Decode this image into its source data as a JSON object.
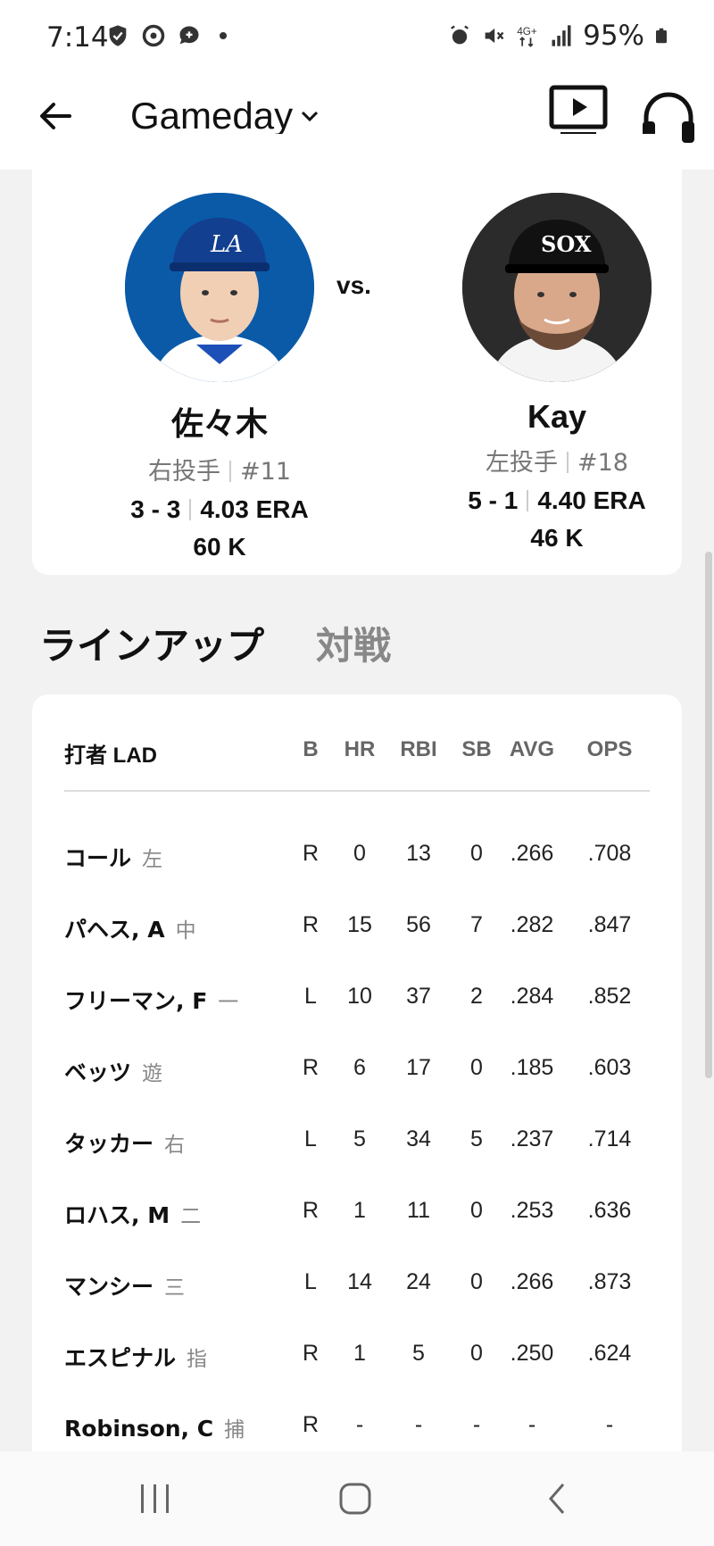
{
  "status": {
    "time": "7:14",
    "battery": "95%"
  },
  "appbar": {
    "title": "Gameday"
  },
  "matchup": {
    "vs": "vs.",
    "home": {
      "name": "佐々木",
      "role": "右投手",
      "number": "#11",
      "record": "3 - 3",
      "era": "4.03 ERA",
      "k": "60 K",
      "team_color": "#0a5aa8"
    },
    "away": {
      "name": "Kay",
      "role": "左投手",
      "number": "#18",
      "record": "5 - 1",
      "era": "4.40 ERA",
      "k": "46 K",
      "team_color": "#2b2b2b"
    }
  },
  "tabs": [
    {
      "label": "ラインアップ"
    },
    {
      "label": "対戦"
    }
  ],
  "lineup": {
    "headers": {
      "batter": "打者 LAD",
      "b": "B",
      "hr": "HR",
      "rbi": "RBI",
      "sb": "SB",
      "avg": "AVG",
      "ops": "OPS"
    },
    "rows": [
      {
        "name": "コール",
        "pos": "左",
        "b": "R",
        "hr": "0",
        "rbi": "13",
        "sb": "0",
        "avg": ".266",
        "ops": ".708"
      },
      {
        "name": "パヘス, A",
        "pos": "中",
        "b": "R",
        "hr": "15",
        "rbi": "56",
        "sb": "7",
        "avg": ".282",
        "ops": ".847"
      },
      {
        "name": "フリーマン, F",
        "pos": "一",
        "b": "L",
        "hr": "10",
        "rbi": "37",
        "sb": "2",
        "avg": ".284",
        "ops": ".852"
      },
      {
        "name": "ベッツ",
        "pos": "遊",
        "b": "R",
        "hr": "6",
        "rbi": "17",
        "sb": "0",
        "avg": ".185",
        "ops": ".603"
      },
      {
        "name": "タッカー",
        "pos": "右",
        "b": "L",
        "hr": "5",
        "rbi": "34",
        "sb": "5",
        "avg": ".237",
        "ops": ".714"
      },
      {
        "name": "ロハス, M",
        "pos": "二",
        "b": "R",
        "hr": "1",
        "rbi": "11",
        "sb": "0",
        "avg": ".253",
        "ops": ".636"
      },
      {
        "name": "マンシー",
        "pos": "三",
        "b": "L",
        "hr": "14",
        "rbi": "24",
        "sb": "0",
        "avg": ".266",
        "ops": ".873"
      },
      {
        "name": "エスピナル",
        "pos": "指",
        "b": "R",
        "hr": "1",
        "rbi": "5",
        "sb": "0",
        "avg": ".250",
        "ops": ".624"
      },
      {
        "name": "Robinson, C",
        "pos": "捕",
        "b": "R",
        "hr": "-",
        "rbi": "-",
        "sb": "-",
        "avg": "-",
        "ops": "-"
      }
    ]
  }
}
